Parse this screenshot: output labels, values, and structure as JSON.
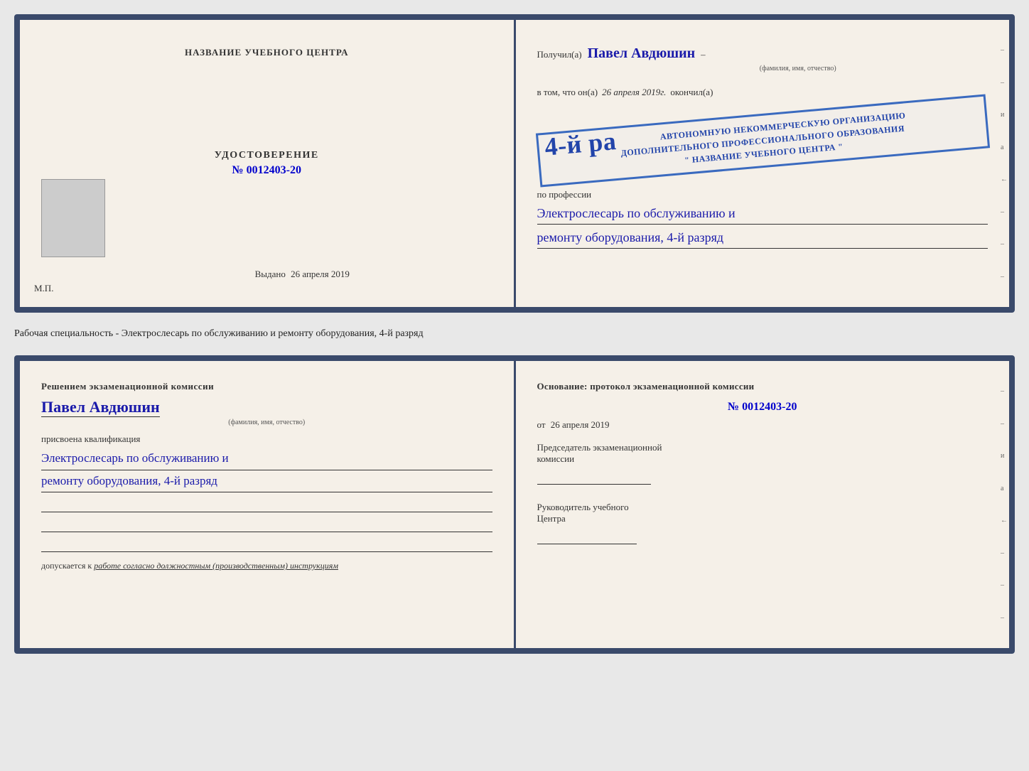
{
  "top_doc": {
    "left": {
      "center_title": "НАЗВАНИЕ УЧЕБНОГО ЦЕНТРА",
      "udostoverenie_label": "УДОСТОВЕРЕНИЕ",
      "udostoverenie_number": "№ 0012403-20",
      "vydano_label": "Выдано",
      "vydano_date": "26 апреля 2019",
      "mp_label": "М.П."
    },
    "right": {
      "poluchil_label": "Получил(а)",
      "name": "Павел Авдюшин",
      "fio_small": "(фамилия, имя, отчество)",
      "vtom_label": "в том, что он(а)",
      "date_italic": "26 апреля 2019г.",
      "okonchil_label": "окончил(а)",
      "stamp_line1": "АВТОНОМНУЮ НЕКОММЕРЧЕСКУЮ ОРГАНИЗАЦИЮ",
      "stamp_line2": "ДОПОЛНИТЕЛЬНОГО ПРОФЕССИОНАЛЬНОГО ОБРАЗОВАНИЯ",
      "stamp_line3": "\" НАЗВАНИЕ УЧЕБНОГО ЦЕНТРА \"",
      "rank_label": "4-й ра",
      "po_professii_label": "по профессии",
      "profession_line1": "Электрослесарь по обслуживанию и",
      "profession_line2": "ремонту оборудования, 4-й разряд"
    }
  },
  "separator": {
    "text": "Рабочая специальность - Электрослесарь по обслуживанию и ремонту оборудования, 4-й разряд"
  },
  "bottom_doc": {
    "left": {
      "reshenie_label": "Решением экзаменационной комиссии",
      "name": "Павел Авдюшин",
      "fio_small": "(фамилия, имя, отчество)",
      "prisvoena_label": "присвоена квалификация",
      "qualification_line1": "Электрослесарь по обслуживанию и",
      "qualification_line2": "ремонту оборудования, 4-й разряд",
      "dopuskaetsya_label": "допускается к",
      "dopuskaetsya_italic": "работе согласно должностным (производственным) инструкциям"
    },
    "right": {
      "osnovanie_label": "Основание: протокол экзаменационной комиссии",
      "number": "№  0012403-20",
      "ot_label": "от",
      "ot_date": "26 апреля 2019",
      "predsedatel_line1": "Председатель экзаменационной",
      "predsedatel_line2": "комиссии",
      "rukovoditel_line1": "Руководитель учебного",
      "rukovoditel_line2": "Центра"
    }
  },
  "side_marks": [
    "–",
    "–",
    "и",
    "а",
    "←",
    "–",
    "–",
    "–"
  ]
}
